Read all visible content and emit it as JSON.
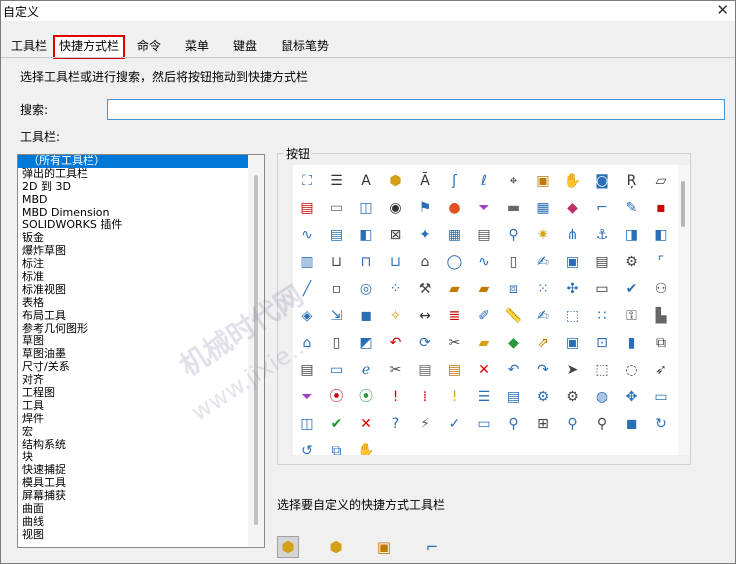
{
  "window": {
    "title": "自定义",
    "close_glyph": "✕"
  },
  "tabs": [
    {
      "label": "工具栏"
    },
    {
      "label": "快捷方式栏",
      "active": true
    },
    {
      "label": "命令"
    },
    {
      "label": "菜单"
    },
    {
      "label": "键盘"
    },
    {
      "label": "鼠标笔势"
    }
  ],
  "instruction": "选择工具栏或进行搜索，然后将按钮拖动到快捷方式栏",
  "search": {
    "label": "搜索:",
    "value": "",
    "placeholder": ""
  },
  "toolbars": {
    "label": "工具栏:",
    "items": [
      "（所有工具栏）",
      "弹出的工具栏",
      "2D 到 3D",
      "MBD",
      "MBD Dimension",
      "SOLIDWORKS 插件",
      "钣金",
      "爆炸草图",
      "标注",
      "标准",
      "标准视图",
      "表格",
      "布局工具",
      "参考几何图形",
      "草图",
      "草图油墨",
      "尺寸/关系",
      "对齐",
      "工程图",
      "工具",
      "焊件",
      "宏",
      "结构系统",
      "块",
      "快速捕捉",
      "模具工具",
      "屏幕捕获",
      "曲面",
      "曲线",
      "视图"
    ],
    "selected_index": 0
  },
  "buttons": {
    "label": "按钮",
    "icons": [
      {
        "name": "sketch-entity-icon",
        "g": "⛶",
        "c": "#2a6fb5"
      },
      {
        "name": "text-format-icon",
        "g": "☰",
        "c": "#333"
      },
      {
        "name": "font-icon",
        "g": "A",
        "c": "#333"
      },
      {
        "name": "3d-box-icon",
        "g": "⬢",
        "c": "#d4a017"
      },
      {
        "name": "note-icon",
        "g": "Ā",
        "c": "#333"
      },
      {
        "name": "spline-icon",
        "g": "ʃ",
        "c": "#2a6fb5"
      },
      {
        "name": "path-icon",
        "g": "ℓ",
        "c": "#2a6fb5"
      },
      {
        "name": "target-icon",
        "g": "⌖",
        "c": "#222"
      },
      {
        "name": "sheet-icon",
        "g": "▣",
        "c": "#c07a00"
      },
      {
        "name": "hand-part-icon",
        "g": "✋",
        "c": "#c07a00"
      },
      {
        "name": "camera-icon",
        "g": "◙",
        "c": "#2a6fb5"
      },
      {
        "name": "dimension-icon",
        "g": "Ŗ",
        "c": "#333"
      },
      {
        "name": "parallelogram-icon",
        "g": "▱",
        "c": "#444"
      },
      {
        "name": "hatch-icon",
        "g": "▤",
        "c": "#c00"
      },
      {
        "name": "document-icon",
        "g": "▭",
        "c": "#666"
      },
      {
        "name": "drawing-icon",
        "g": "◫",
        "c": "#2a6fb5"
      },
      {
        "name": "circle-point-icon",
        "g": "◉",
        "c": "#333"
      },
      {
        "name": "flag-icon",
        "g": "⚑",
        "c": "#2a6fb5"
      },
      {
        "name": "color-wheel-icon",
        "g": "●",
        "c": "#e05020"
      },
      {
        "name": "filter-icon",
        "g": "⏷",
        "c": "#a040c0"
      },
      {
        "name": "window-icon",
        "g": "▬",
        "c": "#666"
      },
      {
        "name": "assembly-icon",
        "g": "▦",
        "c": "#2a6fb5"
      },
      {
        "name": "material-icon",
        "g": "◆",
        "c": "#c0306a"
      },
      {
        "name": "line-corner-icon",
        "g": "⌐",
        "c": "#2a6fb5"
      },
      {
        "name": "pencil-icon",
        "g": "✎",
        "c": "#2a6fb5"
      },
      {
        "name": "screen-icon",
        "g": "▪",
        "c": "#c00"
      },
      {
        "name": "wave-icon",
        "g": "∿",
        "c": "#2a6fb5"
      },
      {
        "name": "save-doc-icon",
        "g": "▤",
        "c": "#2a6fb5"
      },
      {
        "name": "box-icon",
        "g": "◧",
        "c": "#2a6fb5"
      },
      {
        "name": "cross-box-icon",
        "g": "⊠",
        "c": "#444"
      },
      {
        "name": "pin-icon",
        "g": "✦",
        "c": "#2a6fb5"
      },
      {
        "name": "table-icon",
        "g": "▦",
        "c": "#2a6fb5"
      },
      {
        "name": "list-icon",
        "g": "▤",
        "c": "#555"
      },
      {
        "name": "zoom-icon",
        "g": "⚲",
        "c": "#2a6fb5"
      },
      {
        "name": "gear-part-icon",
        "g": "✷",
        "c": "#d4a017"
      },
      {
        "name": "fork-icon",
        "g": "⋔",
        "c": "#2a6fb5"
      },
      {
        "name": "anchor-icon",
        "g": "⚓",
        "c": "#2a6fb5"
      },
      {
        "name": "section-icon",
        "g": "◨",
        "c": "#2a6fb5"
      },
      {
        "name": "section2-icon",
        "g": "◧",
        "c": "#2a6fb5"
      },
      {
        "name": "grid-sheet-icon",
        "g": "▥",
        "c": "#2a6fb5"
      },
      {
        "name": "cut-icon",
        "g": "⊔",
        "c": "#444"
      },
      {
        "name": "extrude-icon",
        "g": "⊓",
        "c": "#2a6fb5"
      },
      {
        "name": "revolve-icon",
        "g": "⊔",
        "c": "#2a6fb5"
      },
      {
        "name": "swept-icon",
        "g": "⌂",
        "c": "#444"
      },
      {
        "name": "ellipse-icon",
        "g": "◯",
        "c": "#2a6fb5"
      },
      {
        "name": "spline2-icon",
        "g": "∿",
        "c": "#2a6fb5"
      },
      {
        "name": "blank-sheet-icon",
        "g": "▯",
        "c": "#444"
      },
      {
        "name": "edit-doc-icon",
        "g": "✍",
        "c": "#2a6fb5"
      },
      {
        "name": "disk-icon",
        "g": "▣",
        "c": "#2a6fb5"
      },
      {
        "name": "printer-icon",
        "g": "▤",
        "c": "#444"
      },
      {
        "name": "settings-icon",
        "g": "⚙",
        "c": "#444"
      },
      {
        "name": "corner-icon",
        "g": "⌜",
        "c": "#2a6fb5"
      },
      {
        "name": "line-icon",
        "g": "╱",
        "c": "#2a6fb5"
      },
      {
        "name": "point-box-icon",
        "g": "▫",
        "c": "#444"
      },
      {
        "name": "camera-part-icon",
        "g": "◎",
        "c": "#2a6fb5"
      },
      {
        "name": "nodes-icon",
        "g": "⁘",
        "c": "#2a6fb5"
      },
      {
        "name": "wrench-icon",
        "g": "⚒",
        "c": "#444"
      },
      {
        "name": "folder-open-icon",
        "g": "▰",
        "c": "#c07a00"
      },
      {
        "name": "folder-add-icon",
        "g": "▰",
        "c": "#c07a00"
      },
      {
        "name": "mirror-icon",
        "g": "⧈",
        "c": "#2a6fb5"
      },
      {
        "name": "pattern-icon",
        "g": "⁙",
        "c": "#2a6fb5"
      },
      {
        "name": "cross-tool-icon",
        "g": "✣",
        "c": "#2a6fb5"
      },
      {
        "name": "monitor-icon",
        "g": "▭",
        "c": "#333"
      },
      {
        "name": "check-tool-icon",
        "g": "✔",
        "c": "#2a6fb5"
      },
      {
        "name": "magnet-icon",
        "g": "⚇",
        "c": "#444"
      },
      {
        "name": "cube-color-icon",
        "g": "◈",
        "c": "#2a6fb5"
      },
      {
        "name": "export-icon",
        "g": "⇲",
        "c": "#2a6fb5"
      },
      {
        "name": "part-icon",
        "g": "◼",
        "c": "#2a6fb5"
      },
      {
        "name": "sparkle-icon",
        "g": "✧",
        "c": "#d4a017"
      },
      {
        "name": "measure-icon",
        "g": "↔",
        "c": "#333"
      },
      {
        "name": "rainbow-icon",
        "g": "≣",
        "c": "#c00"
      },
      {
        "name": "paint-icon",
        "g": "✐",
        "c": "#2a6fb5"
      },
      {
        "name": "ruler-icon",
        "g": "📏",
        "c": "#444"
      },
      {
        "name": "curve-doc-icon",
        "g": "✍",
        "c": "#2a6fb5"
      },
      {
        "name": "bounding-box-icon",
        "g": "⬚",
        "c": "#2a6fb5"
      },
      {
        "name": "dots-icon",
        "g": "∷",
        "c": "#2a6fb5"
      },
      {
        "name": "lock-icon",
        "g": "⚿",
        "c": "#444"
      },
      {
        "name": "chart-part-icon",
        "g": "▙",
        "c": "#666"
      },
      {
        "name": "home-icon",
        "g": "⌂",
        "c": "#2a6fb5"
      },
      {
        "name": "page-icon",
        "g": "▯",
        "c": "#444"
      },
      {
        "name": "component-icon",
        "g": "◩",
        "c": "#2a6fb5"
      },
      {
        "name": "undo-doc-icon",
        "g": "↶",
        "c": "#c00"
      },
      {
        "name": "refresh-doc-icon",
        "g": "⟳",
        "c": "#2a6fb5"
      },
      {
        "name": "cut-doc-icon",
        "g": "✂",
        "c": "#444"
      },
      {
        "name": "open-part-icon",
        "g": "▰",
        "c": "#d4a017"
      },
      {
        "name": "color-part-icon",
        "g": "◆",
        "c": "#2a9a3a"
      },
      {
        "name": "folder-arrow-icon",
        "g": "⇗",
        "c": "#c07a00"
      },
      {
        "name": "window-save-icon",
        "g": "▣",
        "c": "#2a6fb5"
      },
      {
        "name": "crop-icon",
        "g": "⊡",
        "c": "#2a6fb5"
      },
      {
        "name": "bookmark-icon",
        "g": "▮",
        "c": "#2a6fb5"
      },
      {
        "name": "copy-doc-icon",
        "g": "⧉",
        "c": "#444"
      },
      {
        "name": "print-icon",
        "g": "▤",
        "c": "#444"
      },
      {
        "name": "screen-view-icon",
        "g": "▭",
        "c": "#2a6fb5"
      },
      {
        "name": "ie-icon",
        "g": "ℯ",
        "c": "#2a6fb5"
      },
      {
        "name": "scissors-icon",
        "g": "✂",
        "c": "#444"
      },
      {
        "name": "paste-icon",
        "g": "▤",
        "c": "#666"
      },
      {
        "name": "paste2-icon",
        "g": "▤",
        "c": "#c07a00"
      },
      {
        "name": "delete-icon",
        "g": "✕",
        "c": "#d00"
      },
      {
        "name": "undo-icon",
        "g": "↶",
        "c": "#2a6fb5"
      },
      {
        "name": "redo-icon",
        "g": "↷",
        "c": "#2a6fb5"
      },
      {
        "name": "select-icon",
        "g": "➤",
        "c": "#444"
      },
      {
        "name": "select-box-icon",
        "g": "⬚",
        "c": "#444"
      },
      {
        "name": "lasso-icon",
        "g": "◌",
        "c": "#444"
      },
      {
        "name": "pointer-icon",
        "g": "➶",
        "c": "#444"
      },
      {
        "name": "filter2-icon",
        "g": "⏷",
        "c": "#a040c0"
      },
      {
        "name": "traffic-icon",
        "g": "⦿",
        "c": "#c00"
      },
      {
        "name": "traffic2-icon",
        "g": "⦿",
        "c": "#2a9a3a"
      },
      {
        "name": "rebuild-red-icon",
        "g": "!",
        "c": "#d00"
      },
      {
        "name": "rebuild-icon",
        "g": "⁞",
        "c": "#d00"
      },
      {
        "name": "rebuild-yellow-icon",
        "g": "!",
        "c": "#d4a017"
      },
      {
        "name": "options-icon",
        "g": "☰",
        "c": "#2a6fb5"
      },
      {
        "name": "list-view-icon",
        "g": "▤",
        "c": "#2a6fb5"
      },
      {
        "name": "gear-list-icon",
        "g": "⚙",
        "c": "#2a6fb5"
      },
      {
        "name": "gear2-icon",
        "g": "⚙",
        "c": "#444"
      },
      {
        "name": "globe-icon",
        "g": "◍",
        "c": "#2a6fb5"
      },
      {
        "name": "move-icon",
        "g": "✥",
        "c": "#2a6fb5"
      },
      {
        "name": "tile-h-icon",
        "g": "▭",
        "c": "#2a6fb5"
      },
      {
        "name": "tile-v-icon",
        "g": "◫",
        "c": "#2a6fb5"
      },
      {
        "name": "ok-icon",
        "g": "✔",
        "c": "#1a9a2a"
      },
      {
        "name": "cancel-icon",
        "g": "✕",
        "c": "#d00"
      },
      {
        "name": "help-icon",
        "g": "?",
        "c": "#2a6fb5"
      },
      {
        "name": "flashlight-icon",
        "g": "⚡",
        "c": "#666"
      },
      {
        "name": "check-part-icon",
        "g": "✓",
        "c": "#2a6fb5"
      },
      {
        "name": "window-zoom-icon",
        "g": "▭",
        "c": "#2a6fb5"
      },
      {
        "name": "zoom-part-icon",
        "g": "⚲",
        "c": "#2a6fb5"
      },
      {
        "name": "zoom-fit-icon",
        "g": "⊞",
        "c": "#444"
      },
      {
        "name": "zoom-in-icon",
        "g": "⚲",
        "c": "#2a6fb5"
      },
      {
        "name": "zoom-out-icon",
        "g": "⚲",
        "c": "#444"
      },
      {
        "name": "cube-icon",
        "g": "◼",
        "c": "#2a6fb5"
      },
      {
        "name": "rotate-icon",
        "g": "↻",
        "c": "#2a6fb5"
      },
      {
        "name": "rotate2-icon",
        "g": "↺",
        "c": "#2a6fb5"
      },
      {
        "name": "view-icon",
        "g": "⧉",
        "c": "#2a6fb5"
      },
      {
        "name": "hand-icon",
        "g": "✋",
        "c": "#c07a00"
      }
    ]
  },
  "shortcut_section": {
    "label": "选择要自定义的快捷方式工具栏",
    "buttons": [
      {
        "name": "part-shortcut-button",
        "g": "⬢",
        "c": "#d4a017",
        "pressed": true
      },
      {
        "name": "assembly-shortcut-button",
        "g": "⬢",
        "c": "#d4a017",
        "pressed": false
      },
      {
        "name": "drawing-shortcut-button",
        "g": "▣",
        "c": "#c07a00",
        "pressed": false
      },
      {
        "name": "sketch-shortcut-button",
        "g": "⌐",
        "c": "#2a6fb5",
        "pressed": false
      }
    ]
  },
  "watermark": {
    "line1": "机械时代网",
    "line2": "www.jixie..."
  }
}
